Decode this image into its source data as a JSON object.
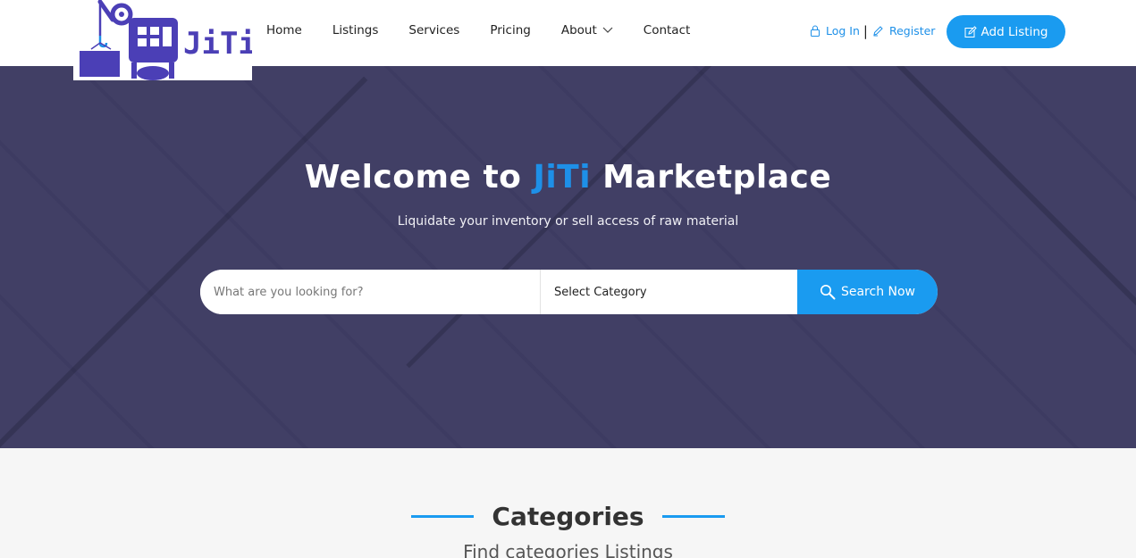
{
  "logo": {
    "text": "JiTi",
    "icon": "jiti-crane-logo"
  },
  "nav": {
    "items": [
      {
        "label": "Home"
      },
      {
        "label": "Listings"
      },
      {
        "label": "Services"
      },
      {
        "label": "Pricing"
      },
      {
        "label": "About"
      },
      {
        "label": "Contact"
      }
    ]
  },
  "auth": {
    "login_label": "Log In",
    "separator": "|",
    "register_label": "Register"
  },
  "add_listing": {
    "label": "Add Listing"
  },
  "hero": {
    "title_prefix": "Welcome to ",
    "title_brand": "JiTi",
    "title_suffix": " Marketplace",
    "subtitle": "Liquidate your inventory or sell access of raw material"
  },
  "search": {
    "placeholder": "What are you looking for?",
    "category_selected": "Select Category",
    "button_label": "Search Now"
  },
  "categories": {
    "title": "Categories",
    "subtitle": "Find categories Listings"
  },
  "colors": {
    "accent": "#1a9bf0",
    "brand_text": "#1e90e8",
    "logo_purple": "#4b3fb6",
    "hero_overlay": "#3a3862"
  }
}
